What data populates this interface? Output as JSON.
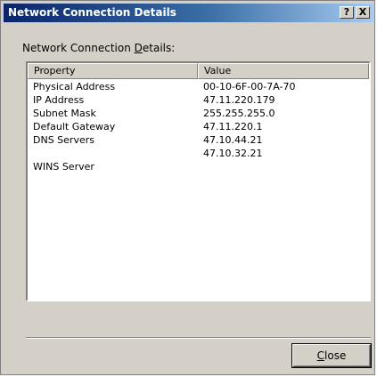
{
  "window": {
    "title": "Network Connection Details",
    "help_button": "?",
    "close_button": "X"
  },
  "section": {
    "label_prefix": "Network Connection ",
    "label_mnemonic": "D",
    "label_suffix": "etails:"
  },
  "table": {
    "columns": [
      "Property",
      "Value"
    ],
    "rows": [
      {
        "property": "Physical Address",
        "value": "00-10-6F-00-7A-70"
      },
      {
        "property": "IP Address",
        "value": "47.11.220.179"
      },
      {
        "property": "Subnet Mask",
        "value": "255.255.255.0"
      },
      {
        "property": "Default Gateway",
        "value": "47.11.220.1"
      },
      {
        "property": "DNS Servers",
        "value": "47.10.44.21"
      },
      {
        "property": "",
        "value": "47.10.32.21"
      },
      {
        "property": "WINS Server",
        "value": ""
      }
    ]
  },
  "footer": {
    "close_mnemonic": "C",
    "close_rest": "lose"
  }
}
